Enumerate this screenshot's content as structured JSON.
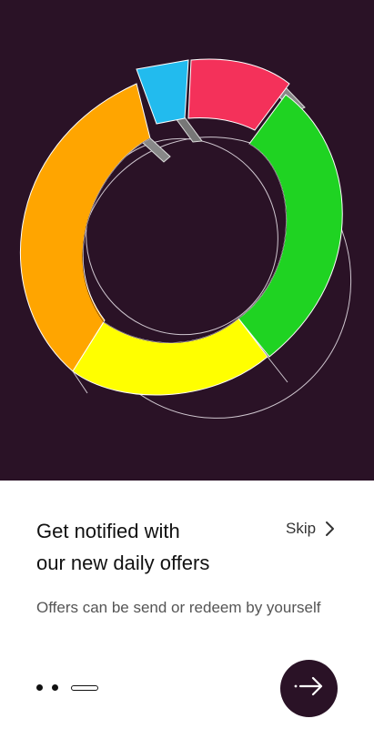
{
  "onboarding": {
    "title": "Get notified with\nour new daily offers",
    "skip_label": "Skip",
    "subtitle": "Offers can be send or redeem by yourself",
    "page_indicator": {
      "total": 3,
      "current": 3
    }
  },
  "colors": {
    "hero_background": "#2a1226",
    "ring_segments": [
      "#ffa500",
      "#22bbee",
      "#f4315a",
      "#1fd322",
      "#ffff00"
    ],
    "next_button": "#2a1226"
  },
  "icons": {
    "skip": "chevron-right-icon",
    "next": "arrow-right-icon"
  }
}
